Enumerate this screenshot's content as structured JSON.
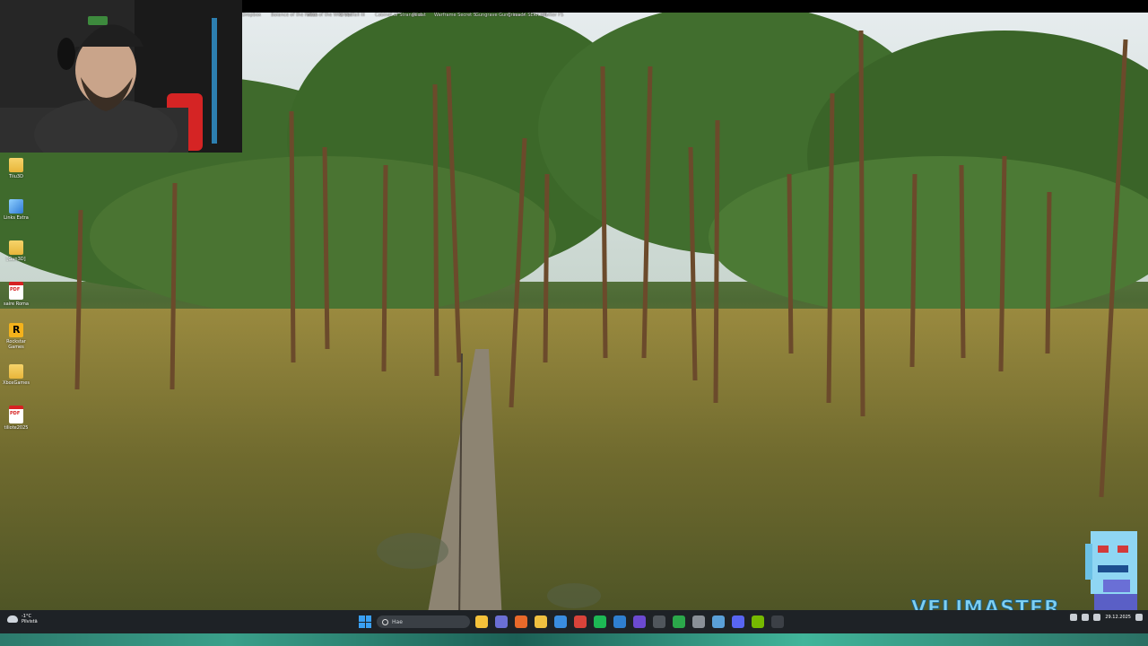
{
  "top_labels": [
    "Dropbox",
    "Balance of the Fallen",
    "Hate of the Wild Ver",
    "Greedfall III",
    "Cabinet of Strange dat",
    "Pilot",
    "Warframe Secret S",
    "Gungrave Gungrave V",
    "Crimson SERIOUS",
    "Slutter FS"
  ],
  "desktop_icons": [
    {
      "label": "Tiiu3D",
      "icon": "folder-icon"
    },
    {
      "label": "Links Extra",
      "icon": "shortcut-icon"
    },
    {
      "label": "[Gun3D]",
      "icon": "folder-icon"
    },
    {
      "label": "saire Roma",
      "icon": "pdf-icon"
    },
    {
      "label": "Rockstar Games",
      "icon": "rockstar-icon"
    },
    {
      "label": "XboxGames",
      "icon": "folder-icon"
    },
    {
      "label": "tiliote2025",
      "icon": "pdf-icon"
    }
  ],
  "watermark": "VELIMASTER",
  "taskbar": {
    "weather_temp": "-1°C",
    "weather_desc": "Pilvistä",
    "search_placeholder": "Hae",
    "date": "29.12.2025",
    "apps": [
      {
        "name": "file-explorer-icon",
        "color": "#f3c13a"
      },
      {
        "name": "teams-icon",
        "color": "#6b6fd4"
      },
      {
        "name": "firefox-icon",
        "color": "#e8692a"
      },
      {
        "name": "folder-icon",
        "color": "#f0c040"
      },
      {
        "name": "store-icon",
        "color": "#3a8de0"
      },
      {
        "name": "chrome-icon",
        "color": "#d9433a"
      },
      {
        "name": "spotify-icon",
        "color": "#1db954"
      },
      {
        "name": "steam-icon",
        "color": "#2f7fd0"
      },
      {
        "name": "obs-icon",
        "color": "#6c4ad0"
      },
      {
        "name": "calculator-icon",
        "color": "#50565c"
      },
      {
        "name": "xbox-icon",
        "color": "#2ba84a"
      },
      {
        "name": "settings-icon",
        "color": "#8a9097"
      },
      {
        "name": "tools-icon",
        "color": "#5aa0d8"
      },
      {
        "name": "discord-icon",
        "color": "#5865f2"
      },
      {
        "name": "nvidia-icon",
        "color": "#76b900"
      },
      {
        "name": "terminal-icon",
        "color": "#3c4046"
      }
    ]
  },
  "colors": {
    "taskbar": "#1e2226",
    "watermark": "#7ed0f2",
    "accent": "#3aa0f3"
  }
}
